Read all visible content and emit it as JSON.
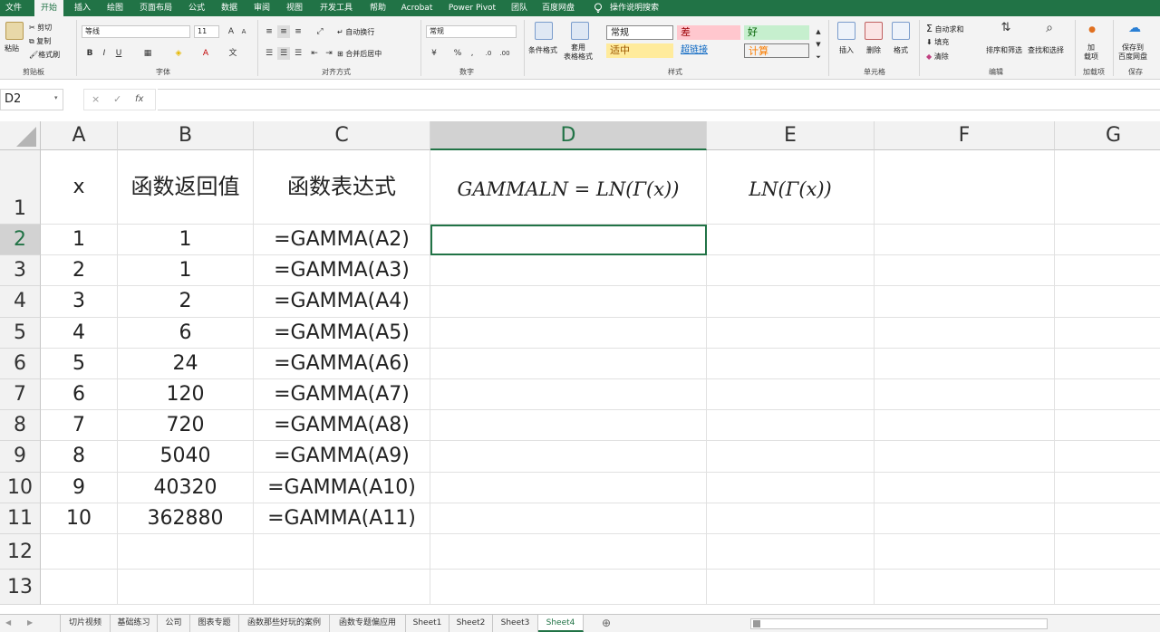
{
  "ribbon_tabs": [
    "文件",
    "开始",
    "插入",
    "绘图",
    "页面布局",
    "公式",
    "数据",
    "审阅",
    "视图",
    "开发工具",
    "帮助",
    "Acrobat",
    "Power Pivot",
    "团队",
    "百度网盘",
    "操作说明搜索"
  ],
  "clipboard": {
    "paste": "粘贴",
    "cut": "剪切",
    "copy": "复制",
    "format_painter": "格式刷",
    "label": "剪贴板"
  },
  "font": {
    "name": "等线",
    "size": "11",
    "label": "字体",
    "bold": "B",
    "italic": "I",
    "underline": "U",
    "color_a": "A"
  },
  "alignment": {
    "wrap": "自动换行",
    "merge": "合并后居中",
    "label": "对齐方式"
  },
  "number": {
    "format": "常规",
    "percent": "%",
    "comma": ",",
    "label": "数字"
  },
  "styles": {
    "conditional": "条件格式",
    "table_format": "套用\n表格格式",
    "normal": "常规",
    "bad": "差",
    "good": "好",
    "neutral": "适中",
    "hyperlink": "超链接",
    "calc": "计算",
    "label": "样式"
  },
  "cells_group": {
    "insert": "插入",
    "delete": "删除",
    "format": "格式",
    "label": "单元格"
  },
  "editing": {
    "autosum": "自动求和",
    "fill": "填充",
    "clear": "清除",
    "sort": "排序和筛选",
    "find": "查找和选择",
    "label": "编辑"
  },
  "addins": {
    "addin": "加\n载项",
    "label": "加载项"
  },
  "save": {
    "save_to": "保存到\n百度网盘",
    "label": "保存"
  },
  "name_box": "D2",
  "formula_icons": {
    "cancel": "×",
    "enter": "✓",
    "fx": "fx"
  },
  "columns": [
    "A",
    "B",
    "C",
    "D",
    "E",
    "F",
    "G"
  ],
  "selected_column": "D",
  "selected_row": "2",
  "header_row": {
    "row": "1",
    "a": "x",
    "b": "函数返回值",
    "c": "函数表达式",
    "d": "GAMMALN = LN(Γ(x))",
    "e": "LN(Γ(x))"
  },
  "rows": [
    {
      "row": "2",
      "x": "1",
      "value": "1",
      "expr": "=GAMMA(A2)"
    },
    {
      "row": "3",
      "x": "2",
      "value": "1",
      "expr": "=GAMMA(A3)"
    },
    {
      "row": "4",
      "x": "3",
      "value": "2",
      "expr": "=GAMMA(A4)"
    },
    {
      "row": "5",
      "x": "4",
      "value": "6",
      "expr": "=GAMMA(A5)"
    },
    {
      "row": "6",
      "x": "5",
      "value": "24",
      "expr": "=GAMMA(A6)"
    },
    {
      "row": "7",
      "x": "6",
      "value": "120",
      "expr": "=GAMMA(A7)"
    },
    {
      "row": "8",
      "x": "7",
      "value": "720",
      "expr": "=GAMMA(A8)"
    },
    {
      "row": "9",
      "x": "8",
      "value": "5040",
      "expr": "=GAMMA(A9)"
    },
    {
      "row": "10",
      "x": "9",
      "value": "40320",
      "expr": "=GAMMA(A10)"
    },
    {
      "row": "11",
      "x": "10",
      "value": "362880",
      "expr": "=GAMMA(A11)"
    }
  ],
  "empty_rows": [
    "12",
    "13"
  ],
  "sheet_tabs": [
    "切片视频",
    "基础练习",
    "公司",
    "图表专题",
    "函数那些好玩的案例",
    "函数专题偏应用",
    "Sheet1",
    "Sheet2",
    "Sheet3",
    "Sheet4"
  ],
  "active_sheet": "Sheet4",
  "add_sheet": "⊕",
  "colors": {
    "excel_green": "#217346",
    "bad_bg": "#ffc7ce",
    "bad_fg": "#9c0006",
    "good_bg": "#c6efce",
    "good_fg": "#006100",
    "neutral_bg": "#ffeb9c",
    "neutral_fg": "#9c5700",
    "calc_bg": "#f2f2f2",
    "calc_fg": "#fa7d00"
  }
}
